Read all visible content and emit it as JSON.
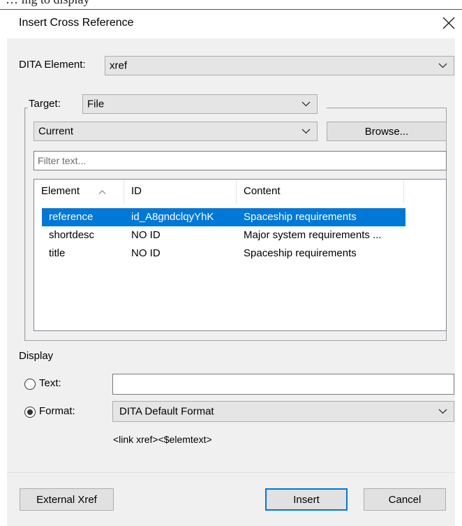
{
  "window": {
    "partial_text_above": "… ing to display"
  },
  "dialog": {
    "title": "Insert Cross Reference",
    "close_icon": "close-x-icon"
  },
  "dita_element": {
    "label": "DITA Element:",
    "value": "xref"
  },
  "target": {
    "label": "Target:",
    "type_value": "File",
    "file_value": "Current",
    "browse_label": "Browse...",
    "filter_placeholder": "Filter text..."
  },
  "table": {
    "columns": [
      "Element",
      "ID",
      "Content"
    ],
    "sort_column": "Element",
    "sort_direction": "ascending",
    "rows": [
      {
        "element": "reference",
        "id": "id_A8gndclqyYhK",
        "content": "Spaceship requirements",
        "selected": true
      },
      {
        "element": "shortdesc",
        "id": "NO ID",
        "content": "Major system requirements ...",
        "selected": false
      },
      {
        "element": "title",
        "id": "NO ID",
        "content": "Spaceship requirements",
        "selected": false
      }
    ]
  },
  "display": {
    "section_label": "Display",
    "text_option_label": "Text:",
    "text_value": "",
    "format_option_label": "Format:",
    "selected_option": "format",
    "format_value": "DITA Default Format",
    "format_preview": "<link xref><$elemtext>"
  },
  "buttons": {
    "external_xref": "External Xref",
    "insert": "Insert",
    "cancel": "Cancel"
  },
  "colors": {
    "selection": "#0078d7",
    "dialog_bg": "#f0f0f0",
    "button_bg": "#e1e1e1"
  }
}
